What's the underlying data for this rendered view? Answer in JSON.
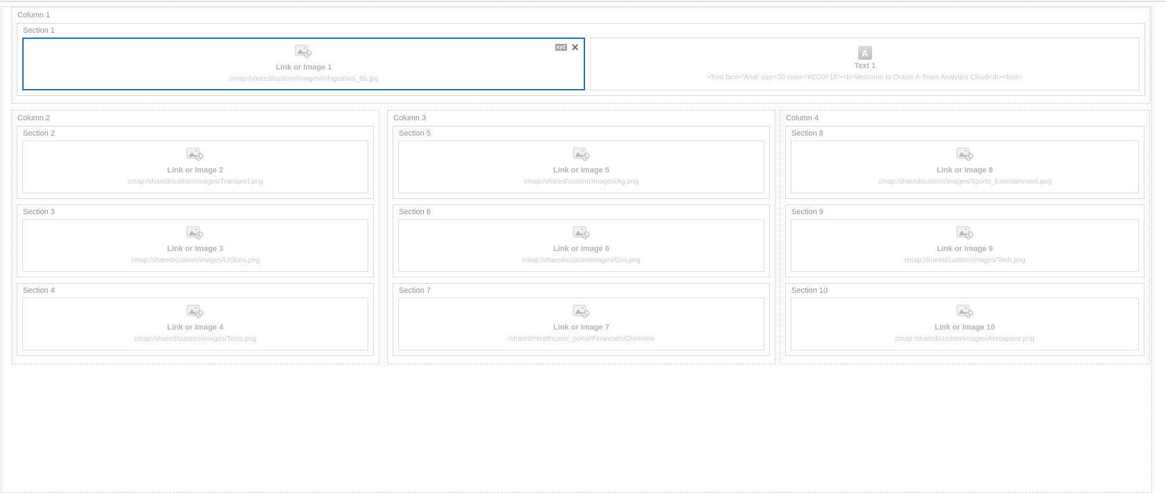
{
  "icons": {
    "xyz_label": "xyz",
    "close_glyph": "✕",
    "text_glyph": "A"
  },
  "selection_color": "#1b75bc",
  "page": {
    "columns": [
      {
        "label": "Column 1",
        "sections": [
          {
            "label": "Section 1",
            "items": [
              {
                "type": "link_image",
                "title": "Link or Image 1",
                "caption": "cmap:/shared/custom/images/infograhics_6b.jpg",
                "selected": true
              },
              {
                "type": "text",
                "title": "Text 1",
                "caption": "<font face='Arial' size=20 color='#CD0F18'><b>Welcome to Oracle A-Team Analytics Cloud</b><font>"
              }
            ]
          }
        ]
      },
      {
        "label": "Column 2",
        "sections": [
          {
            "label": "Section 2",
            "items": [
              {
                "type": "link_image",
                "title": "Link or Image 2",
                "caption": "cmap:/shared/custom/images/Transport.png"
              }
            ]
          },
          {
            "label": "Section 3",
            "items": [
              {
                "type": "link_image",
                "title": "Link or Image 3",
                "caption": "cmap:/shared/custom/images/Utilities.png"
              }
            ]
          },
          {
            "label": "Section 4",
            "items": [
              {
                "type": "link_image",
                "title": "Link or Image 4",
                "caption": "cmap:/shared/custom/images/Telco.png"
              }
            ]
          }
        ]
      },
      {
        "label": "Column 3",
        "sections": [
          {
            "label": "Section 5",
            "items": [
              {
                "type": "link_image",
                "title": "Link or Image 5",
                "caption": "cmap:/shared/custom/images/Ag.png"
              }
            ]
          },
          {
            "label": "Section 6",
            "items": [
              {
                "type": "link_image",
                "title": "Link or Image 6",
                "caption": "cmap:/shared/custom/images/Gov.png"
              }
            ]
          },
          {
            "label": "Section 7",
            "items": [
              {
                "type": "link_image",
                "title": "Link or Image 7",
                "caption": "/shared/Healthcare/_portal/Financials/Overview"
              }
            ]
          }
        ]
      },
      {
        "label": "Column 4",
        "sections": [
          {
            "label": "Section 8",
            "items": [
              {
                "type": "link_image",
                "title": "Link or Image 8",
                "caption": "cmap:/shared/custom/images/Sports_Entertainment.png"
              }
            ]
          },
          {
            "label": "Section 9",
            "items": [
              {
                "type": "link_image",
                "title": "Link or Image 9",
                "caption": "cmap:/shared/custom/images/Tech.png"
              }
            ]
          },
          {
            "label": "Section 10",
            "items": [
              {
                "type": "link_image",
                "title": "Link or Image 10",
                "caption": "cmap:/shared/custom/images/Areospace.png"
              }
            ]
          }
        ]
      }
    ]
  }
}
